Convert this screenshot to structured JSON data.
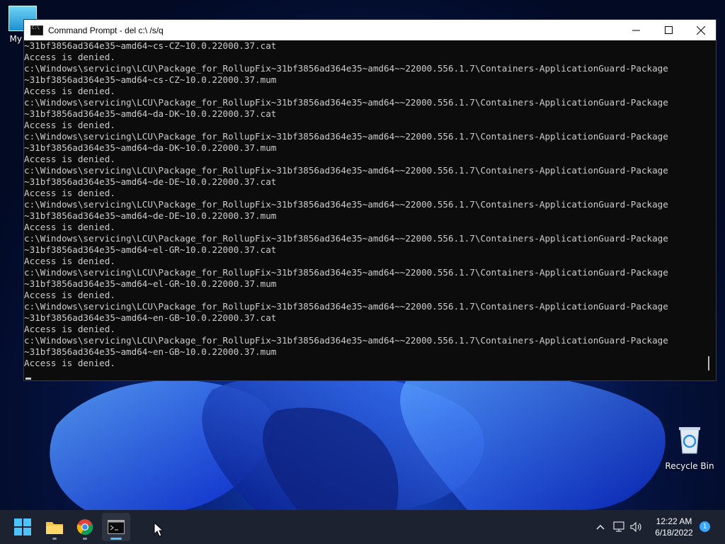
{
  "desktop": {
    "icons": [
      {
        "label": "My Co"
      },
      {
        "label": "Recycle Bin"
      }
    ]
  },
  "window": {
    "title": "Command Prompt - del  c:\\ /s/q",
    "accent": "#0c0c0c",
    "text_color": "#cccccc"
  },
  "console": {
    "lines": [
      "~31bf3856ad364e35~amd64~cs-CZ~10.0.22000.37.cat",
      "Access is denied.",
      "c:\\Windows\\servicing\\LCU\\Package_for_RollupFix~31bf3856ad364e35~amd64~~22000.556.1.7\\Containers-ApplicationGuard-Package",
      "~31bf3856ad364e35~amd64~cs-CZ~10.0.22000.37.mum",
      "Access is denied.",
      "c:\\Windows\\servicing\\LCU\\Package_for_RollupFix~31bf3856ad364e35~amd64~~22000.556.1.7\\Containers-ApplicationGuard-Package",
      "~31bf3856ad364e35~amd64~da-DK~10.0.22000.37.cat",
      "Access is denied.",
      "c:\\Windows\\servicing\\LCU\\Package_for_RollupFix~31bf3856ad364e35~amd64~~22000.556.1.7\\Containers-ApplicationGuard-Package",
      "~31bf3856ad364e35~amd64~da-DK~10.0.22000.37.mum",
      "Access is denied.",
      "c:\\Windows\\servicing\\LCU\\Package_for_RollupFix~31bf3856ad364e35~amd64~~22000.556.1.7\\Containers-ApplicationGuard-Package",
      "~31bf3856ad364e35~amd64~de-DE~10.0.22000.37.cat",
      "Access is denied.",
      "c:\\Windows\\servicing\\LCU\\Package_for_RollupFix~31bf3856ad364e35~amd64~~22000.556.1.7\\Containers-ApplicationGuard-Package",
      "~31bf3856ad364e35~amd64~de-DE~10.0.22000.37.mum",
      "Access is denied.",
      "c:\\Windows\\servicing\\LCU\\Package_for_RollupFix~31bf3856ad364e35~amd64~~22000.556.1.7\\Containers-ApplicationGuard-Package",
      "~31bf3856ad364e35~amd64~el-GR~10.0.22000.37.cat",
      "Access is denied.",
      "c:\\Windows\\servicing\\LCU\\Package_for_RollupFix~31bf3856ad364e35~amd64~~22000.556.1.7\\Containers-ApplicationGuard-Package",
      "~31bf3856ad364e35~amd64~el-GR~10.0.22000.37.mum",
      "Access is denied.",
      "c:\\Windows\\servicing\\LCU\\Package_for_RollupFix~31bf3856ad364e35~amd64~~22000.556.1.7\\Containers-ApplicationGuard-Package",
      "~31bf3856ad364e35~amd64~en-GB~10.0.22000.37.cat",
      "Access is denied.",
      "c:\\Windows\\servicing\\LCU\\Package_for_RollupFix~31bf3856ad364e35~amd64~~22000.556.1.7\\Containers-ApplicationGuard-Package",
      "~31bf3856ad364e35~amd64~en-GB~10.0.22000.37.mum",
      "Access is denied."
    ]
  },
  "taskbar": {
    "apps": [
      "windows-logo-icon",
      "file-explorer-icon",
      "chrome-icon",
      "command-prompt-icon"
    ],
    "clock": {
      "time": "12:22 AM",
      "date": "6/18/2022"
    },
    "notification_count": "1",
    "accent": "#3ea6ff"
  }
}
